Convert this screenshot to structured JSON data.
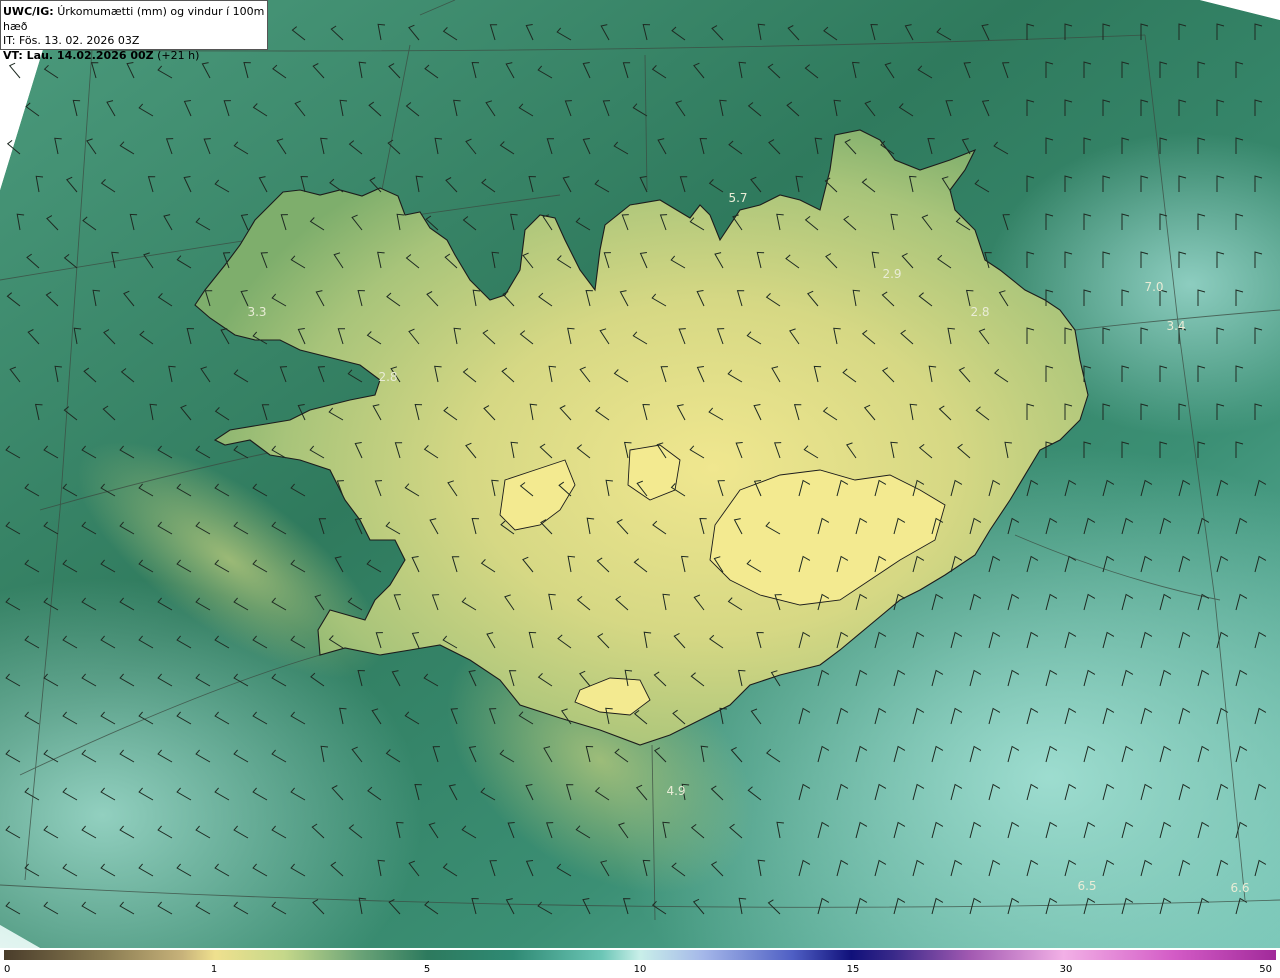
{
  "header": {
    "line1_bold": "UWC/IG:",
    "line1_rest": "Úrkomumætti (mm) og vindur í 100m hæð",
    "line2": "IT: Fös. 13. 02. 2026 03Z",
    "line3_bold": "VT: Lau. 14.02.2026 00Z",
    "line3_rest": "(+21 h)"
  },
  "map_labels": [
    "5.7",
    "2.9",
    "2.8",
    "7.0",
    "3.4",
    "3.3",
    "2.8",
    "4.9",
    "6.5",
    "6.6"
  ],
  "colorbar": {
    "ticks": [
      "0",
      "1",
      "5",
      "10",
      "15",
      "30",
      "50"
    ]
  },
  "colors": {
    "sea_dark": "#2f7f5e",
    "sea_light": "#8fd3c6",
    "land_low": "#7fb56a",
    "land_high": "#f0e58c",
    "outside": "#ffffff"
  }
}
